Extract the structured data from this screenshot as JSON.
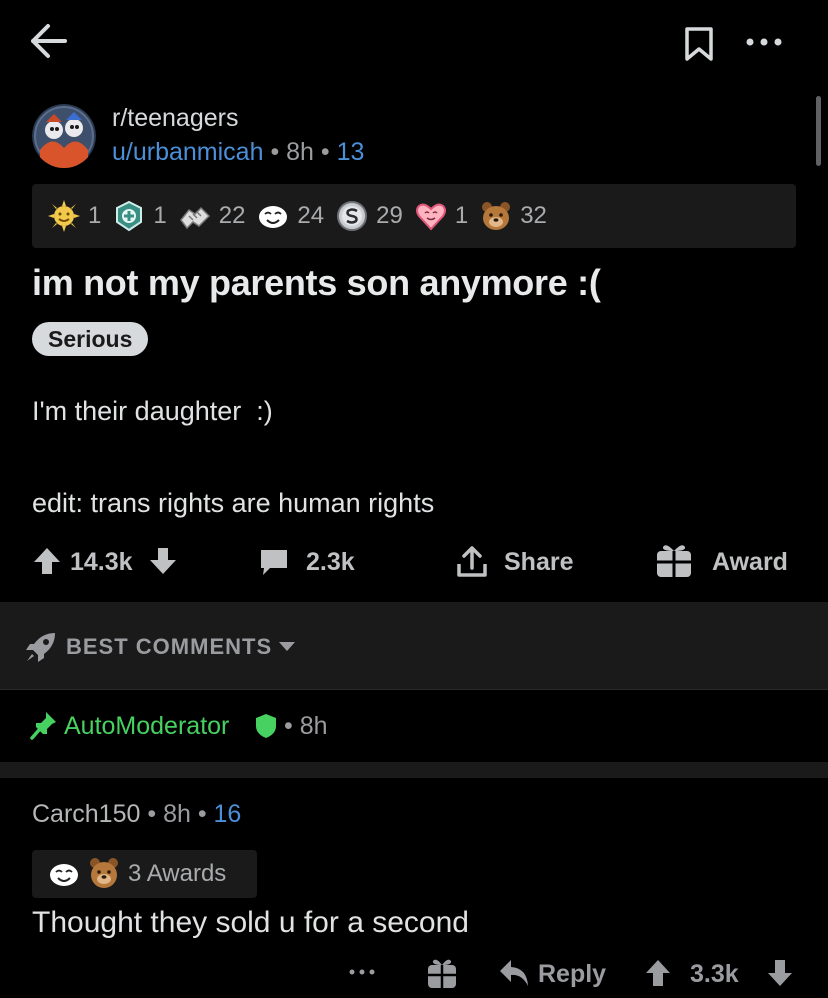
{
  "topbar": {
    "back_icon": "back-arrow-icon",
    "bookmark_icon": "bookmark-icon",
    "more_icon": "more-horizontal-icon"
  },
  "post": {
    "subreddit": "r/teenagers",
    "author": "u/urbanmicah",
    "time": "8h",
    "award_count": "13",
    "awards": [
      {
        "icon": "sun-award-icon",
        "count": "1",
        "color": "#f2c94c"
      },
      {
        "icon": "medic-award-icon",
        "count": "1",
        "color": "#5fc9b3"
      },
      {
        "icon": "handshake-award-icon",
        "count": "22",
        "color": "#e0e0e0"
      },
      {
        "icon": "face-award-icon",
        "count": "24",
        "color": "#ffffff"
      },
      {
        "icon": "silver-coin-award-icon",
        "count": "29",
        "color": "#d7dadc"
      },
      {
        "icon": "heart-award-icon",
        "count": "1",
        "color": "#ff8aa3"
      },
      {
        "icon": "bear-award-icon",
        "count": "32",
        "color": "#b5773a"
      }
    ],
    "title": "im not my parents son anymore :(",
    "flair": "Serious",
    "body_line_1": "I'm their daughter  :)",
    "body_line_2": "edit: trans rights are human rights",
    "score": "14.3k",
    "comments": "2.3k",
    "share_label": "Share",
    "award_label": "Award"
  },
  "sort": {
    "label": "BEST COMMENTS",
    "icon": "rocket-icon"
  },
  "automod": {
    "name": "AutoModerator",
    "time": "8h"
  },
  "comment": {
    "author": "Carch150",
    "time": "8h",
    "award_count": "16",
    "awards_text": "3 Awards",
    "body": "Thought they sold u for a second",
    "reply_label": "Reply",
    "score": "3.3k"
  },
  "colors": {
    "background": "#000000",
    "accent_blue": "#4b8fd8",
    "mod_green": "#46d160",
    "panel": "#1a1a1b"
  }
}
